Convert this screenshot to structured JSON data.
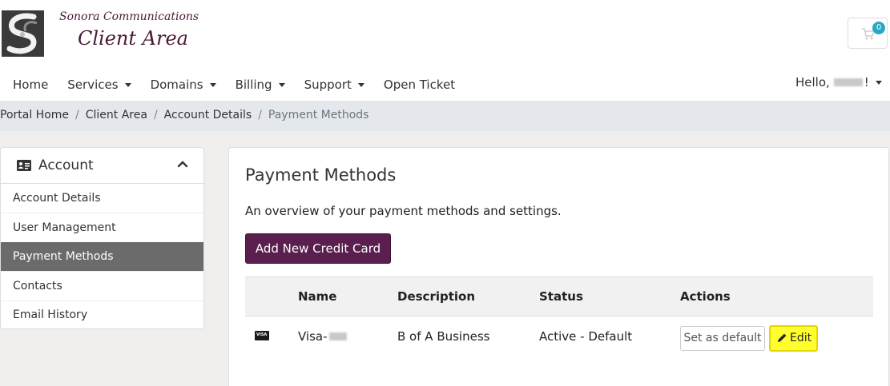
{
  "brand": {
    "subtitle": "Sonora Communications",
    "title": "Client Area"
  },
  "cart": {
    "count": "0"
  },
  "nav": {
    "items": [
      {
        "label": "Home",
        "dropdown": false
      },
      {
        "label": "Services",
        "dropdown": true
      },
      {
        "label": "Domains",
        "dropdown": true
      },
      {
        "label": "Billing",
        "dropdown": true
      },
      {
        "label": "Support",
        "dropdown": true
      },
      {
        "label": "Open Ticket",
        "dropdown": false
      }
    ],
    "hello_prefix": "Hello, ",
    "hello_suffix": "!"
  },
  "breadcrumb": {
    "items": [
      "Portal Home",
      "Client Area",
      "Account Details"
    ],
    "current": "Payment Methods",
    "separator": "/"
  },
  "sidebar": {
    "title": "Account",
    "items": [
      {
        "label": "Account Details"
      },
      {
        "label": "User Management"
      },
      {
        "label": "Payment Methods"
      },
      {
        "label": "Contacts"
      },
      {
        "label": "Email History"
      }
    ]
  },
  "main": {
    "title": "Payment Methods",
    "description": "An overview of your payment methods and settings.",
    "add_button": "Add New Credit Card",
    "table": {
      "headers": {
        "name": "Name",
        "description": "Description",
        "status": "Status",
        "actions": "Actions"
      },
      "rows": [
        {
          "card_brand": "VISA",
          "name": "Visa-",
          "description": "B of A Business",
          "status": "Active - Default",
          "set_default": "Set as default",
          "edit": "Edit"
        }
      ]
    }
  },
  "colors": {
    "brand": "#5a1f4e",
    "active_sidebar": "#6b6b6b",
    "badge": "#29a8c4",
    "highlight": "#ffff30"
  }
}
